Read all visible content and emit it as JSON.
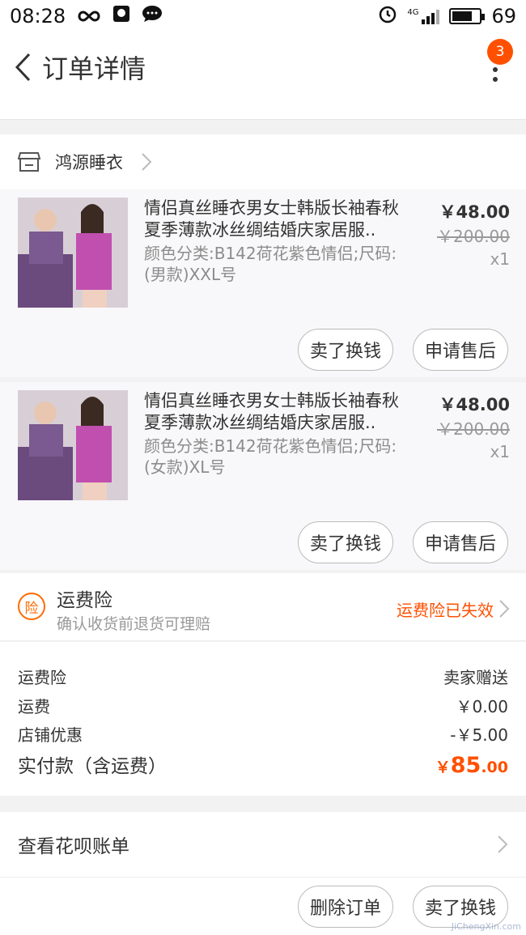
{
  "status_bar": {
    "time": "08:28",
    "battery": "69",
    "network": "4G",
    "icons": [
      "infinity-icon",
      "qq-icon",
      "message-icon",
      "alarm-icon",
      "signal-icon",
      "battery-icon"
    ]
  },
  "nav": {
    "title": "订单详情",
    "badge": "3"
  },
  "shop": {
    "name": "鸿源睡衣"
  },
  "items": [
    {
      "name": "情侣真丝睡衣男女士韩版长袖春秋夏季薄款冰丝绸结婚庆家居服..",
      "sku": "颜色分类:B142荷花紫色情侣;尺码:(男款)XXL号",
      "price": "￥48.00",
      "original_price": "￥200.00",
      "quantity": "x1",
      "btn_sell": "卖了换钱",
      "btn_after_sale": "申请售后"
    },
    {
      "name": "情侣真丝睡衣男女士韩版长袖春秋夏季薄款冰丝绸结婚庆家居服..",
      "sku": "颜色分类:B142荷花紫色情侣;尺码:(女款)XL号",
      "price": "￥48.00",
      "original_price": "￥200.00",
      "quantity": "x1",
      "btn_sell": "卖了换钱",
      "btn_after_sale": "申请售后"
    }
  ],
  "insurance": {
    "icon_text": "险",
    "title": "运费险",
    "subtitle": "确认收货前退货可理赔",
    "status": "运费险已失效"
  },
  "summary": {
    "rows": [
      {
        "label": "运费险",
        "value": "卖家赠送"
      },
      {
        "label": "运费",
        "value": "￥0.00"
      },
      {
        "label": "店铺优惠",
        "value": "-￥5.00"
      }
    ],
    "total_label": "实付款（含运费）",
    "total_currency": "￥",
    "total_int": "85",
    "total_dec": ".00"
  },
  "huabei": {
    "label": "查看花呗账单"
  },
  "footer": {
    "delete_label": "删除订单",
    "sell_label": "卖了换钱"
  },
  "watermark": "JiChengXin.com",
  "colors": {
    "accent": "#ff5000",
    "text": "#333333",
    "muted": "#999999",
    "background": "#f2f2f2"
  }
}
